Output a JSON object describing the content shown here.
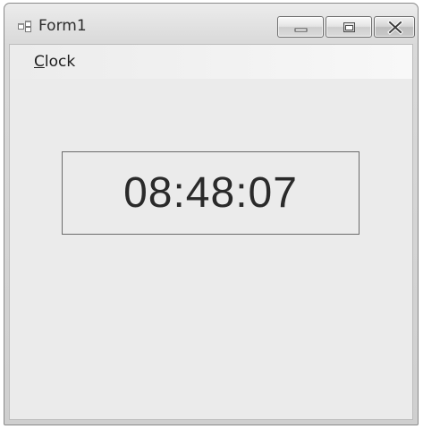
{
  "window": {
    "title": "Form1",
    "icon": "form-window-icon"
  },
  "caption_buttons": {
    "minimize_icon": "minimize-icon",
    "maximize_icon": "maximize-icon",
    "close_icon": "close-icon"
  },
  "menu": {
    "items": [
      {
        "mnemonic": "C",
        "rest": "lock"
      }
    ]
  },
  "clock": {
    "time": "08:48:07"
  },
  "colors": {
    "client_background": "#ebebeb",
    "border": "#6b6b6b",
    "text": "#2a2a2a"
  }
}
